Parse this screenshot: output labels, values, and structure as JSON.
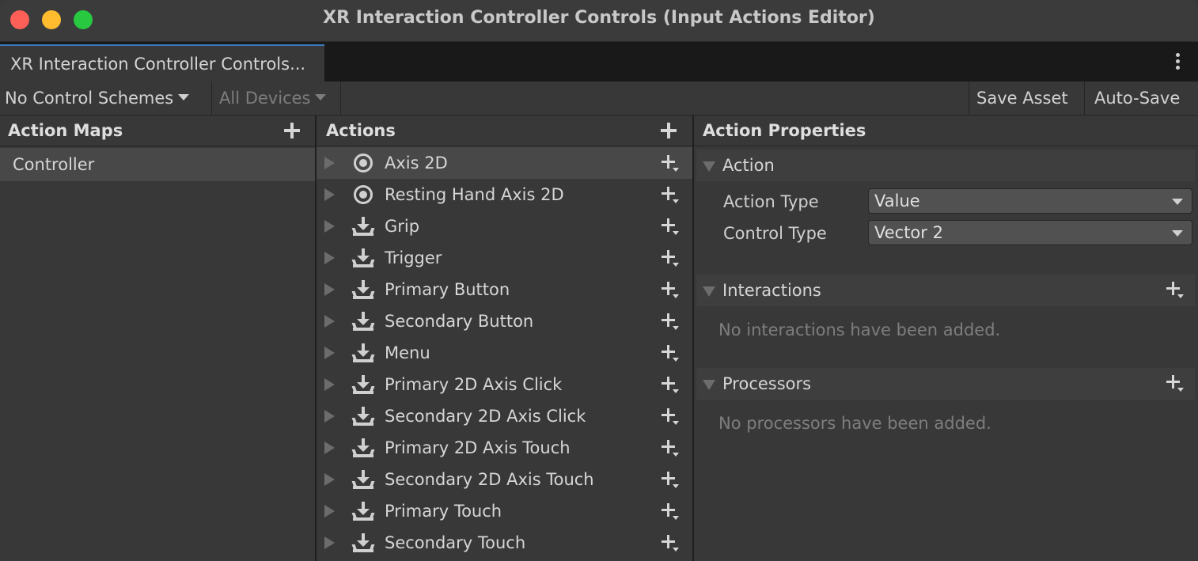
{
  "window": {
    "title": "XR Interaction Controller Controls (Input Actions Editor)",
    "tab_label": "XR Interaction Controller Controls..."
  },
  "toolbar": {
    "control_schemes": "No Control Schemes",
    "devices": "All Devices",
    "save_asset": "Save Asset",
    "auto_save": "Auto-Save"
  },
  "action_maps": {
    "header": "Action Maps",
    "items": [
      {
        "label": "Controller",
        "selected": true
      }
    ]
  },
  "actions": {
    "header": "Actions",
    "items": [
      {
        "label": "Axis 2D",
        "icon": "radio-value-icon",
        "selected": true
      },
      {
        "label": "Resting Hand Axis 2D",
        "icon": "radio-value-icon"
      },
      {
        "label": "Grip",
        "icon": "button-download-icon"
      },
      {
        "label": "Trigger",
        "icon": "button-download-icon"
      },
      {
        "label": "Primary Button",
        "icon": "button-download-icon"
      },
      {
        "label": "Secondary Button",
        "icon": "button-download-icon"
      },
      {
        "label": "Menu",
        "icon": "button-download-icon"
      },
      {
        "label": "Primary 2D Axis Click",
        "icon": "button-download-icon"
      },
      {
        "label": "Secondary 2D Axis Click",
        "icon": "button-download-icon"
      },
      {
        "label": "Primary 2D Axis Touch",
        "icon": "button-download-icon"
      },
      {
        "label": "Secondary 2D Axis Touch",
        "icon": "button-download-icon"
      },
      {
        "label": "Primary Touch",
        "icon": "button-download-icon"
      },
      {
        "label": "Secondary Touch",
        "icon": "button-download-icon"
      }
    ]
  },
  "properties": {
    "header": "Action Properties",
    "action_section": "Action",
    "action_type_label": "Action Type",
    "action_type_value": "Value",
    "control_type_label": "Control Type",
    "control_type_value": "Vector 2",
    "interactions_section": "Interactions",
    "interactions_empty": "No interactions have been added.",
    "processors_section": "Processors",
    "processors_empty": "No processors have been added."
  },
  "colors": {
    "close": "#fe5f57",
    "minimize": "#febc2e",
    "maximize": "#28c840",
    "tab_accent": "#3a79bb",
    "background": "#383838",
    "selection": "#484848"
  }
}
